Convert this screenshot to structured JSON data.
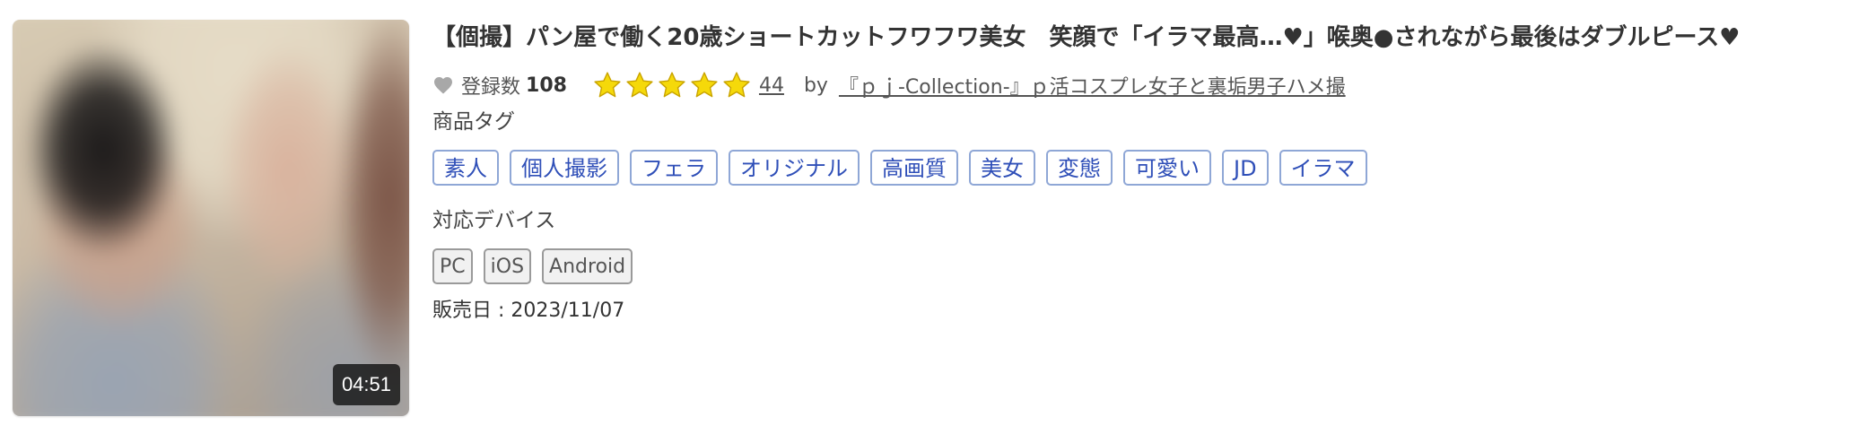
{
  "product": {
    "thumbnail": {
      "duration": "04:51"
    },
    "title": "【個撮】パン屋で働く20歳ショートカットフワフワ美女　笑顔で「イラマ最高…♥」喉奥●されながら最後はダブルピース♥",
    "favorites": {
      "icon": "heart-icon",
      "label": "登録数",
      "count": "108"
    },
    "rating": {
      "icon": "star-icon",
      "star_color": "#f5d90a",
      "stars": 5,
      "review_count": "44"
    },
    "seller": {
      "by_label": "by",
      "name": "『ｐｊ-Collection-』ｐ活コスプレ女子と裏垢男子ハメ撮"
    },
    "tags_label": "商品タグ",
    "tags": [
      "素人",
      "個人撮影",
      "フェラ",
      "オリジナル",
      "高画質",
      "美女",
      "変態",
      "可愛い",
      "JD",
      "イラマ"
    ],
    "devices_label": "対応デバイス",
    "devices": [
      "PC",
      "iOS",
      "Android"
    ],
    "release_date": "販売日 : 2023/11/07"
  },
  "colors": {
    "tag_text": "#2f4fb8",
    "tag_border": "#8fa7d6",
    "device_border": "#9a9a9a",
    "heart": "#a8a8a8"
  }
}
